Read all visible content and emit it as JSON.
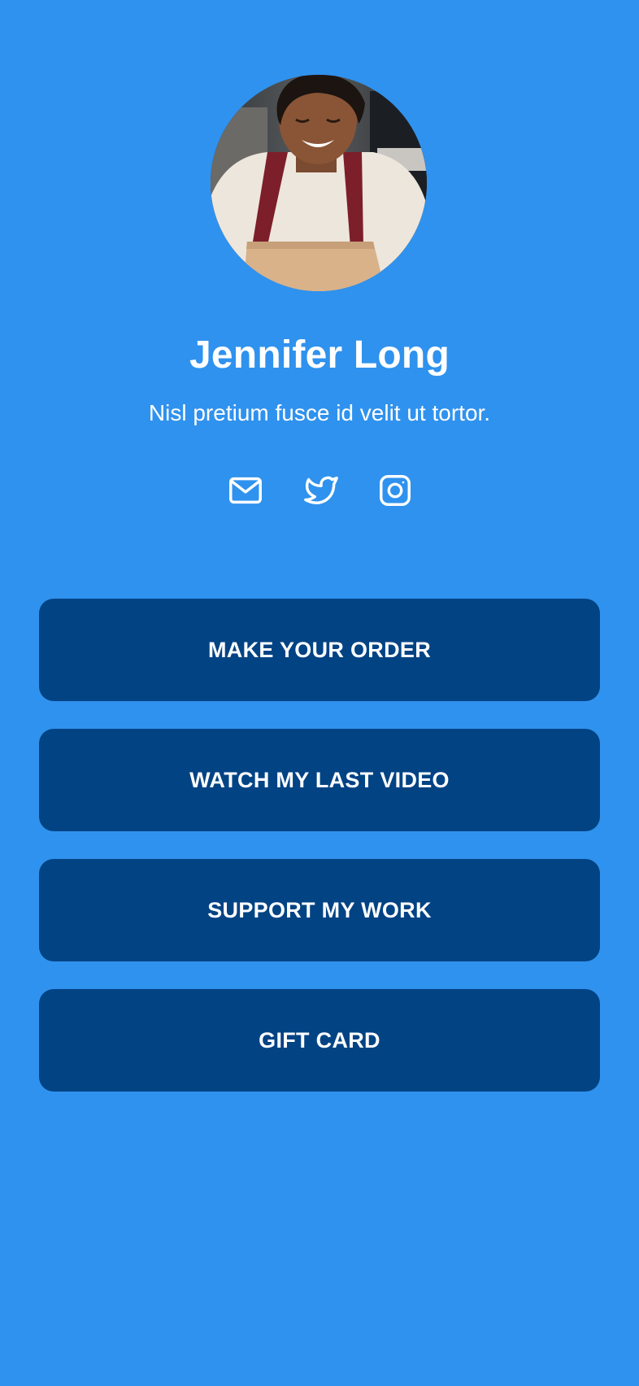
{
  "profile": {
    "name": "Jennifer Long",
    "bio": "Nisl pretium fusce id velit ut tortor.",
    "avatar": "smiling-person-in-apron-photo"
  },
  "socials": [
    {
      "name": "mail-icon",
      "label": "Email"
    },
    {
      "name": "twitter-icon",
      "label": "Twitter"
    },
    {
      "name": "instagram-icon",
      "label": "Instagram"
    }
  ],
  "links": [
    {
      "label": "MAKE YOUR ORDER"
    },
    {
      "label": "WATCH MY LAST VIDEO"
    },
    {
      "label": "SUPPORT MY WORK"
    },
    {
      "label": "GIFT CARD"
    }
  ],
  "colors": {
    "background": "#2f92ee",
    "button": "#024384",
    "text": "#ffffff"
  }
}
